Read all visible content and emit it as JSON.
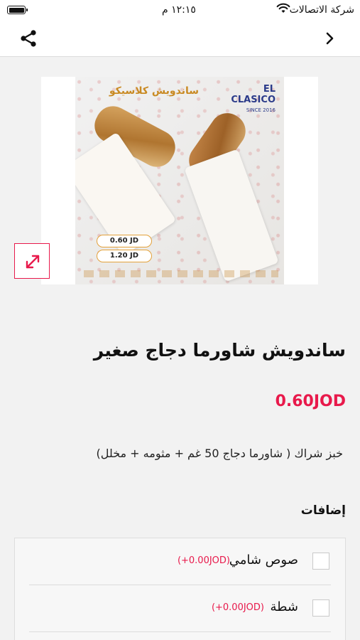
{
  "status_bar": {
    "carrier": "شركة الاتصالات",
    "time": "١٢:١٥ م"
  },
  "nav": {
    "back_icon": "chevron-right-icon",
    "share_icon": "share-icon"
  },
  "product": {
    "image_texts": {
      "title": "ساندويش كلاسيكو",
      "brand": "EL CLASICO",
      "brand_sub": "SINCE 2016",
      "price_small": "0.60 JD",
      "price_large": "1.20 JD"
    },
    "expand_icon": "expand-arrows-icon",
    "title": "ساندويش شاورما دجاج صغير",
    "price": "0.60JOD",
    "description": "خبز شراك ( شاورما دجاج 50 غم + مثومه + مخلل)"
  },
  "addons": {
    "title": "إضافات",
    "items": [
      {
        "label": "صوص شامي",
        "extra": "(+0.00JOD)",
        "checked": false
      },
      {
        "label": "شطة",
        "extra": "(+0.00JOD)",
        "checked": false
      }
    ]
  },
  "colors": {
    "accent": "#e8194b",
    "background": "#f2f2f2"
  }
}
